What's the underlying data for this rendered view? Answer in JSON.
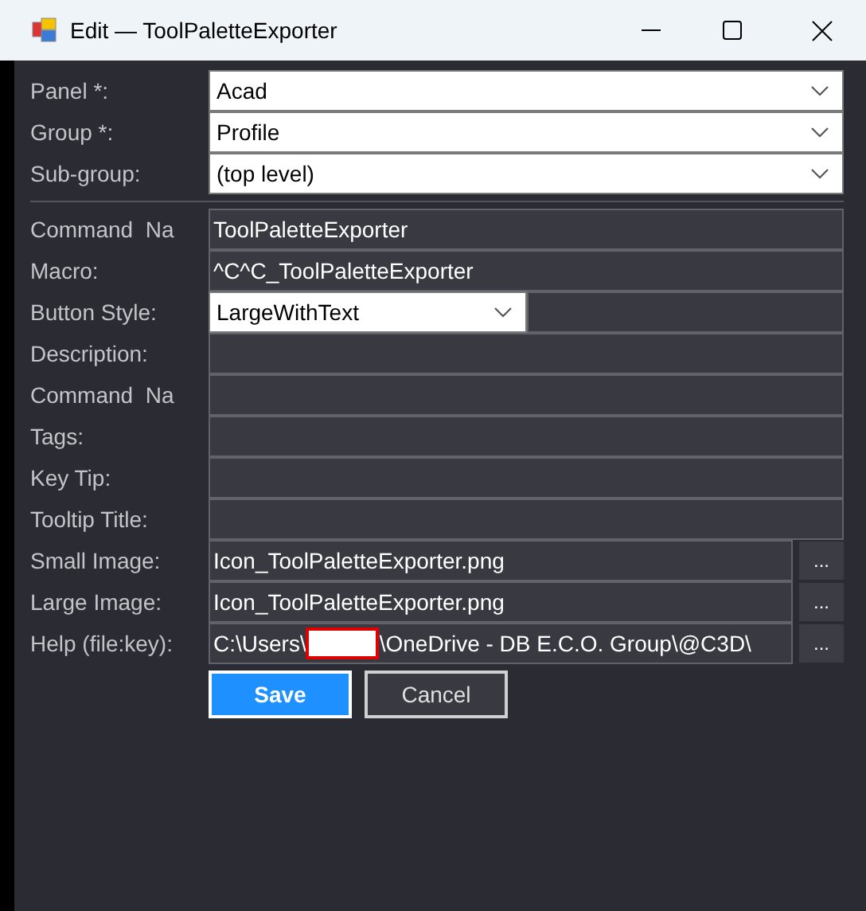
{
  "window": {
    "title": "Edit — ToolPaletteExporter"
  },
  "location": [
    {
      "kind": "select",
      "label": "Panel *:",
      "value": "Acad"
    },
    {
      "kind": "select",
      "label": "Group *:",
      "value": "Profile"
    },
    {
      "kind": "select",
      "label": "Sub-group:",
      "value": "(top level)"
    }
  ],
  "fields": [
    {
      "kind": "text",
      "label": "Command  Na",
      "value": "ToolPaletteExporter"
    },
    {
      "kind": "text",
      "label": "Macro:",
      "value": "^C^C_ToolPaletteExporter"
    },
    {
      "kind": "select-short",
      "label": "Button Style:",
      "value": "LargeWithText"
    },
    {
      "kind": "text",
      "label": "Description:"
    },
    {
      "kind": "text",
      "label": "Command  Na"
    },
    {
      "kind": "text",
      "label": "Tags:"
    },
    {
      "kind": "text",
      "label": "Key Tip:"
    },
    {
      "kind": "text",
      "label": "Tooltip Title:"
    },
    {
      "kind": "file",
      "label": "Small Image:",
      "value": "Icon_ToolPaletteExporter.png",
      "browse": "..."
    },
    {
      "kind": "file",
      "label": "Large Image:",
      "value": "Icon_ToolPaletteExporter.png",
      "browse": "..."
    },
    {
      "kind": "file",
      "label": "Help (file:key):",
      "value": "C:\\Users\\",
      "redacted": true,
      "value_after": "\\OneDrive - DB E.C.O. Group\\@C3D\\",
      "browse": "..."
    }
  ],
  "buttons": [
    {
      "label": "Save",
      "primary": true
    },
    {
      "label": "Cancel",
      "primary": false
    }
  ]
}
